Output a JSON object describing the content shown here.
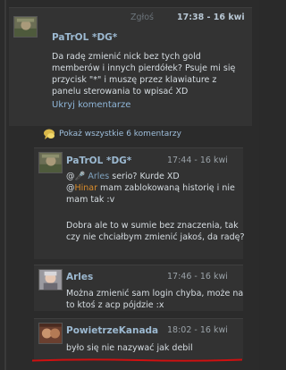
{
  "main_comment": {
    "report_label": "Zgłoś",
    "time": "17:38 - 16 kwi",
    "author": "PaTrOL *DG*",
    "text": "Da radę zmienić nick bez tych gold memberów i innych pierdółek? Psuje mi się przycisk \"*\" i muszę przez klawiature z panelu sterowania to wpisać XD",
    "collapse_link": "Ukryj komentarze"
  },
  "show_all": {
    "label": "Pokaż wszystkie 6 komentarzy"
  },
  "replies": [
    {
      "author": "PaTrOL *DG*",
      "time": "17:44 - 16 kwi",
      "mention1": "Arles",
      "text1_rest": " serio? Kurde XD",
      "mention2": "Hinar",
      "text2_rest": " mam zablokowaną historię i nie mam tak :v",
      "text3": "Dobra ale to w sumie bez znaczenia, tak czy nie chciałbym zmienić jakoś, da radę?"
    },
    {
      "author": "Arles",
      "time": "17:46 - 16 kwi",
      "text": "Można zmienić sam login chyba, może na to ktoś z acp pójdzie :x"
    },
    {
      "author": "PowietrzeKanada",
      "time": "18:02 - 16 kwi",
      "text": "było się nie nazywać jak debil"
    }
  ],
  "colors": {
    "background": "#2b2b2b",
    "username": "#9cb9d1",
    "link": "#8fb6d8",
    "mention": "#d98c2b",
    "underline": "#d01010"
  }
}
